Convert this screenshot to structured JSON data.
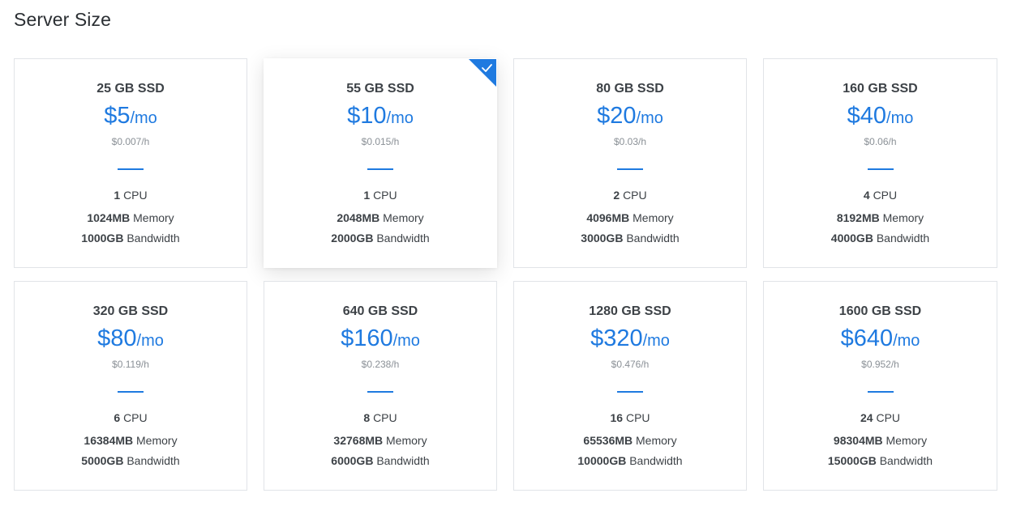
{
  "page": {
    "title": "Server Size"
  },
  "colors": {
    "accent": "#1f7ae0",
    "text": "#3d4247",
    "muted": "#8a9096",
    "border": "#e1e4e8"
  },
  "labels": {
    "cpu": "CPU",
    "memory": "Memory",
    "bandwidth": "Bandwidth",
    "per_month": "/mo"
  },
  "plans": [
    {
      "ssd": "25 GB SSD",
      "price": "$5",
      "hourly": "$0.007/h",
      "cpu": "1",
      "memory": "1024MB",
      "bandwidth": "1000GB",
      "selected": false
    },
    {
      "ssd": "55 GB SSD",
      "price": "$10",
      "hourly": "$0.015/h",
      "cpu": "1",
      "memory": "2048MB",
      "bandwidth": "2000GB",
      "selected": true
    },
    {
      "ssd": "80 GB SSD",
      "price": "$20",
      "hourly": "$0.03/h",
      "cpu": "2",
      "memory": "4096MB",
      "bandwidth": "3000GB",
      "selected": false
    },
    {
      "ssd": "160 GB SSD",
      "price": "$40",
      "hourly": "$0.06/h",
      "cpu": "4",
      "memory": "8192MB",
      "bandwidth": "4000GB",
      "selected": false
    },
    {
      "ssd": "320 GB SSD",
      "price": "$80",
      "hourly": "$0.119/h",
      "cpu": "6",
      "memory": "16384MB",
      "bandwidth": "5000GB",
      "selected": false
    },
    {
      "ssd": "640 GB SSD",
      "price": "$160",
      "hourly": "$0.238/h",
      "cpu": "8",
      "memory": "32768MB",
      "bandwidth": "6000GB",
      "selected": false
    },
    {
      "ssd": "1280 GB SSD",
      "price": "$320",
      "hourly": "$0.476/h",
      "cpu": "16",
      "memory": "65536MB",
      "bandwidth": "10000GB",
      "selected": false
    },
    {
      "ssd": "1600 GB SSD",
      "price": "$640",
      "hourly": "$0.952/h",
      "cpu": "24",
      "memory": "98304MB",
      "bandwidth": "15000GB",
      "selected": false
    }
  ]
}
